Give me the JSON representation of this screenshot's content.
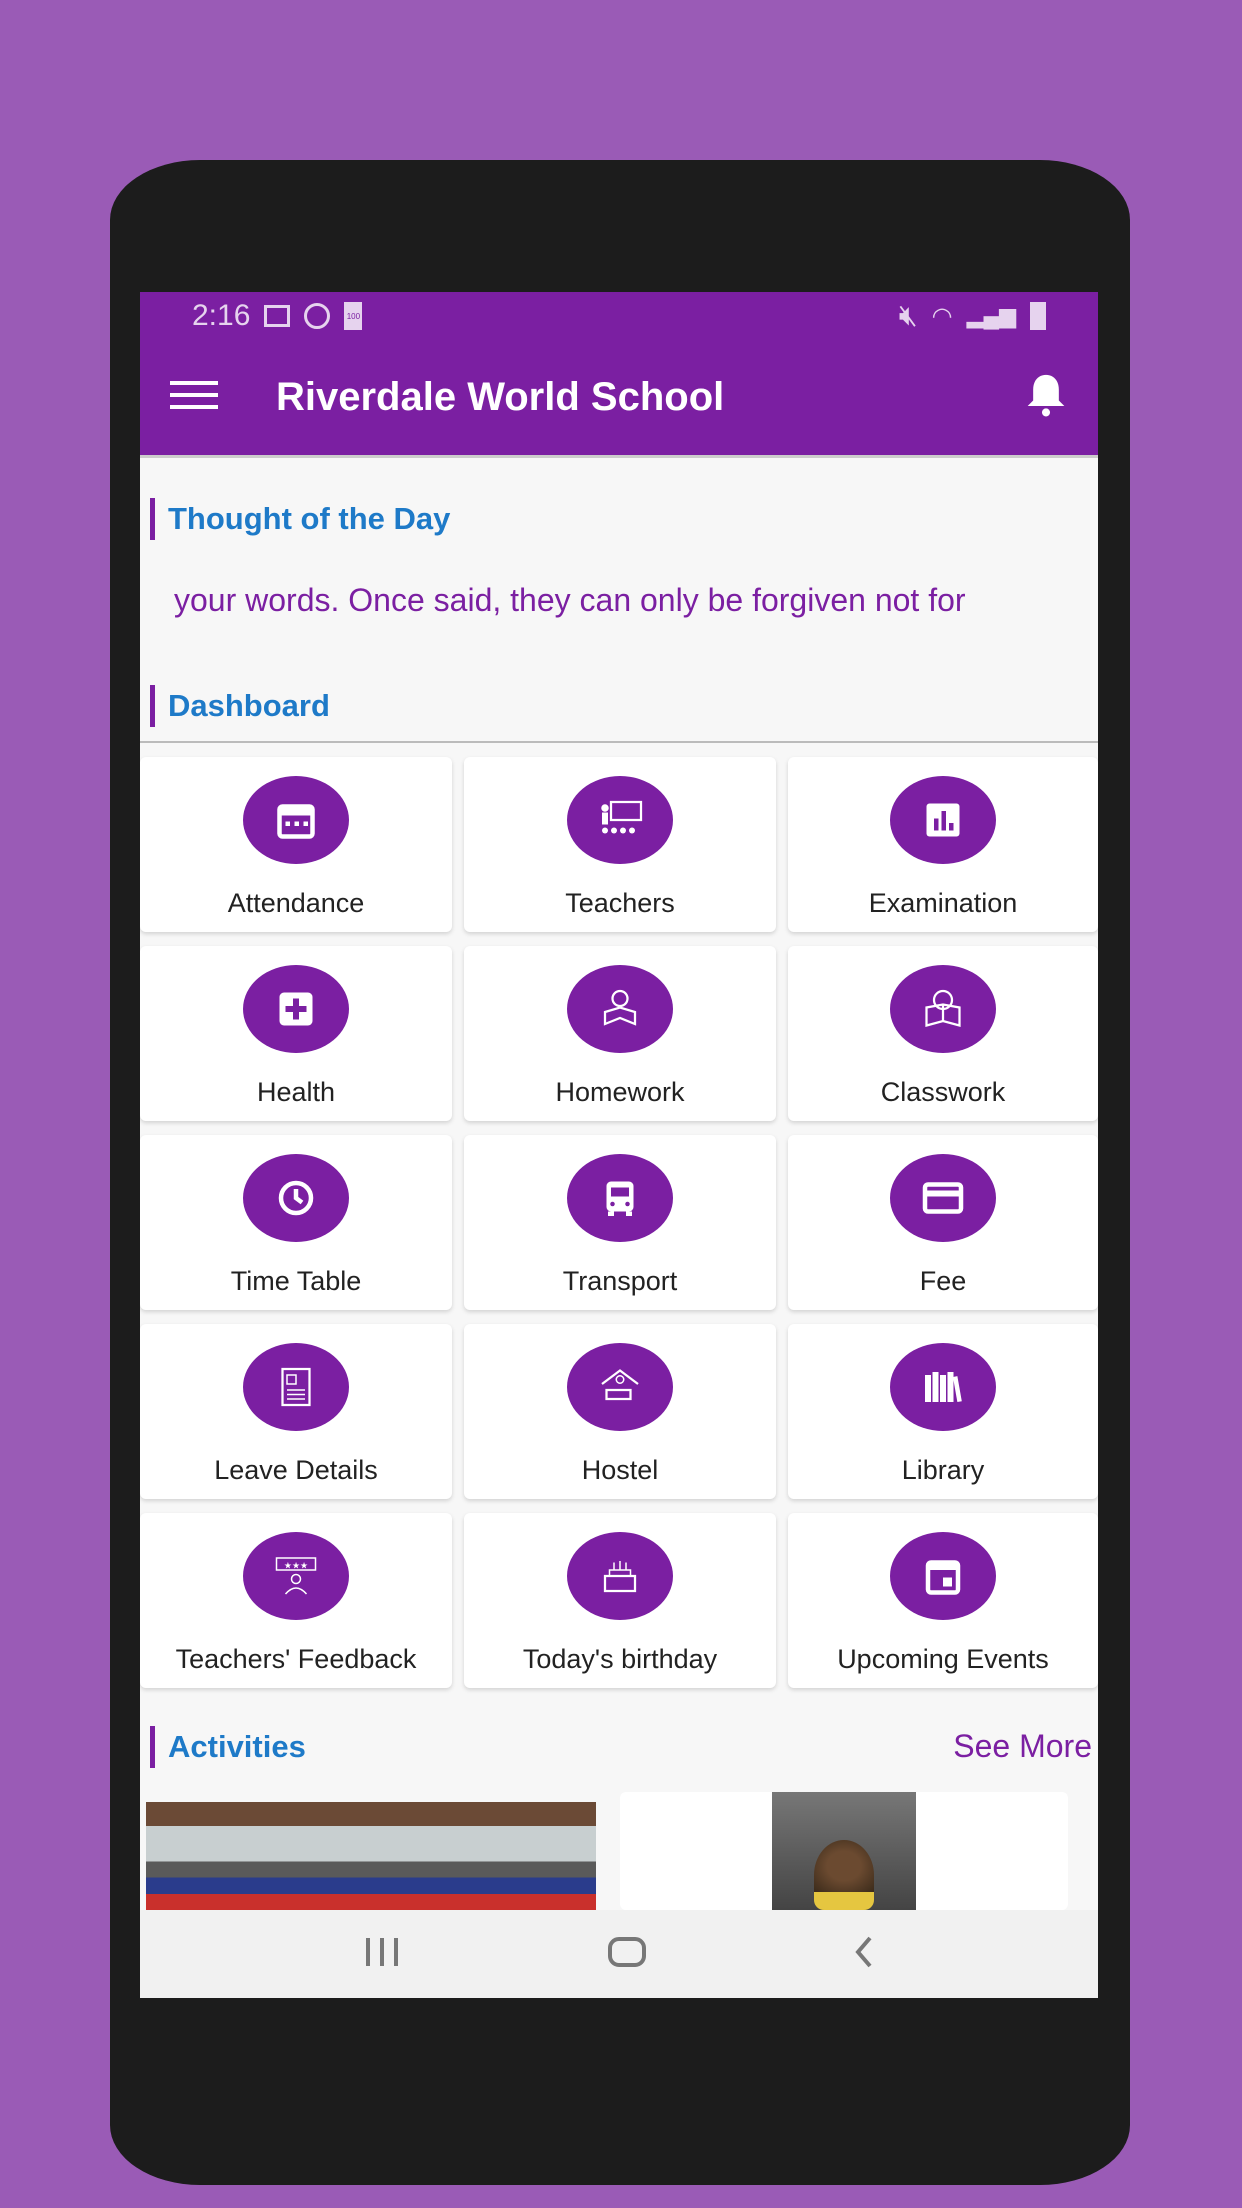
{
  "status_bar": {
    "time": "2:16",
    "battery_saver_label": "100"
  },
  "app_bar": {
    "title": "Riverdale World School"
  },
  "thought": {
    "heading": "Thought of the Day",
    "text": "your words. Once said,  they can only be forgiven not for"
  },
  "dashboard": {
    "heading": "Dashboard",
    "items": [
      {
        "label": "Attendance",
        "icon": "calendar-icon"
      },
      {
        "label": "Teachers",
        "icon": "teacher-board-icon"
      },
      {
        "label": "Examination",
        "icon": "bar-chart-icon"
      },
      {
        "label": "Health",
        "icon": "first-aid-icon"
      },
      {
        "label": "Homework",
        "icon": "student-reading-icon"
      },
      {
        "label": "Classwork",
        "icon": "book-reading-icon"
      },
      {
        "label": "Time Table",
        "icon": "clock-icon"
      },
      {
        "label": "Transport",
        "icon": "bus-icon"
      },
      {
        "label": "Fee",
        "icon": "credit-card-icon"
      },
      {
        "label": "Leave Details",
        "icon": "document-icon"
      },
      {
        "label": "Hostel",
        "icon": "hostel-bed-icon"
      },
      {
        "label": "Library",
        "icon": "books-icon"
      },
      {
        "label": "Teachers' Feedback",
        "icon": "feedback-stars-icon"
      },
      {
        "label": "Today's birthday",
        "icon": "cake-icon"
      },
      {
        "label": "Upcoming Events",
        "icon": "event-calendar-icon"
      }
    ]
  },
  "activities": {
    "heading": "Activities",
    "see_more": "See More"
  },
  "colors": {
    "primary": "#7b1fa2",
    "heading": "#1e7ac8",
    "background": "#9a5bb6"
  }
}
